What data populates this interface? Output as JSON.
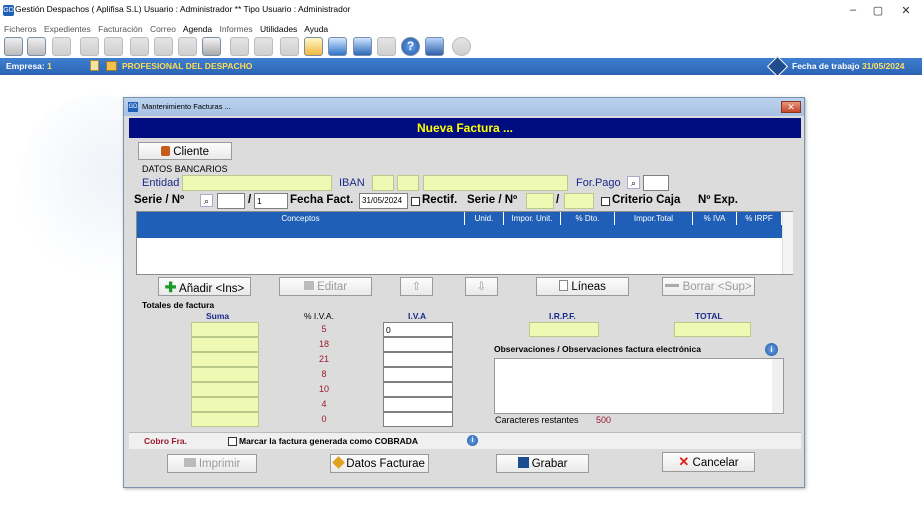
{
  "app": {
    "title": "Gestión Despachos  ( Aplifisa S.L)  Usuario : Administrador  **  Tipo Usuario : Administrador",
    "minimize": "–",
    "maximize": "▢",
    "close": "✕"
  },
  "menu": [
    "Ficheros",
    "Expedientes",
    "Facturación",
    "Correo",
    "Agenda",
    "Informes",
    "Utilidades",
    "Ayuda"
  ],
  "status": {
    "empresa_label": "Empresa:",
    "empresa_value": "1",
    "profesional": "PROFESIONAL DEL DESPACHO",
    "fecha_label": "Fecha de trabajo",
    "fecha_value": "31/05/2024"
  },
  "dialog": {
    "title": "Mantenimiento Facturas ...",
    "header": "Nueva Factura ...",
    "cliente_button": "Cliente",
    "datos_bancarios": "DATOS BANCARIOS",
    "entidad": "Entidad",
    "iban": "IBAN",
    "for_pago": "For.Pago",
    "serie_label": "Serie / Nº",
    "slash": "/",
    "serie_num": "1",
    "fecha_fact_label": "Fecha Fact.",
    "fecha_fact_value": "31/05/2024",
    "rectif": "Rectif.",
    "serie_label2": "Serie / Nº",
    "criterio_caja": "Criterio Caja",
    "n_exp": "Nº Exp.",
    "grid_headers": [
      "Conceptos",
      "Unid.",
      "Impor. Unit.",
      "% Dto.",
      "Impor.Total",
      "% IVA",
      "% IRPF"
    ],
    "buttons": {
      "anadir": "Añadir <Ins>",
      "editar": "Editar",
      "up": "⇧",
      "down": "⇩",
      "lineas": "Líneas",
      "borrar": "Borrar <Sup>"
    },
    "totales_label": "Totales de factura",
    "suma": "Suma",
    "pct_iva": "% I.V.A.",
    "iva": "I.V.A",
    "irpf": "I.R.P.F.",
    "total": "TOTAL",
    "iva_rates": [
      "5",
      "18",
      "21",
      "8",
      "10",
      "4",
      "0"
    ],
    "iva_first_value": "0",
    "observaciones": "Observaciones / Observaciones factura electrónica",
    "caracteres": "Caracteres restantes",
    "caracteres_value": "500",
    "cobro": "Cobro Fra.",
    "marcar": "Marcar la factura generada como COBRADA",
    "imprimir": "Imprimir",
    "datos_facturae": "Datos Facturae",
    "grabar": "Grabar",
    "cancelar": "Cancelar"
  },
  "colors": {
    "header_bg": "#000d80",
    "header_text": "#ffff00",
    "status_bar": "#2b63b4",
    "grid_header": "#1f5fb8",
    "field_yellow": "#eef9b4",
    "pct_red": "#9b1a2f"
  }
}
